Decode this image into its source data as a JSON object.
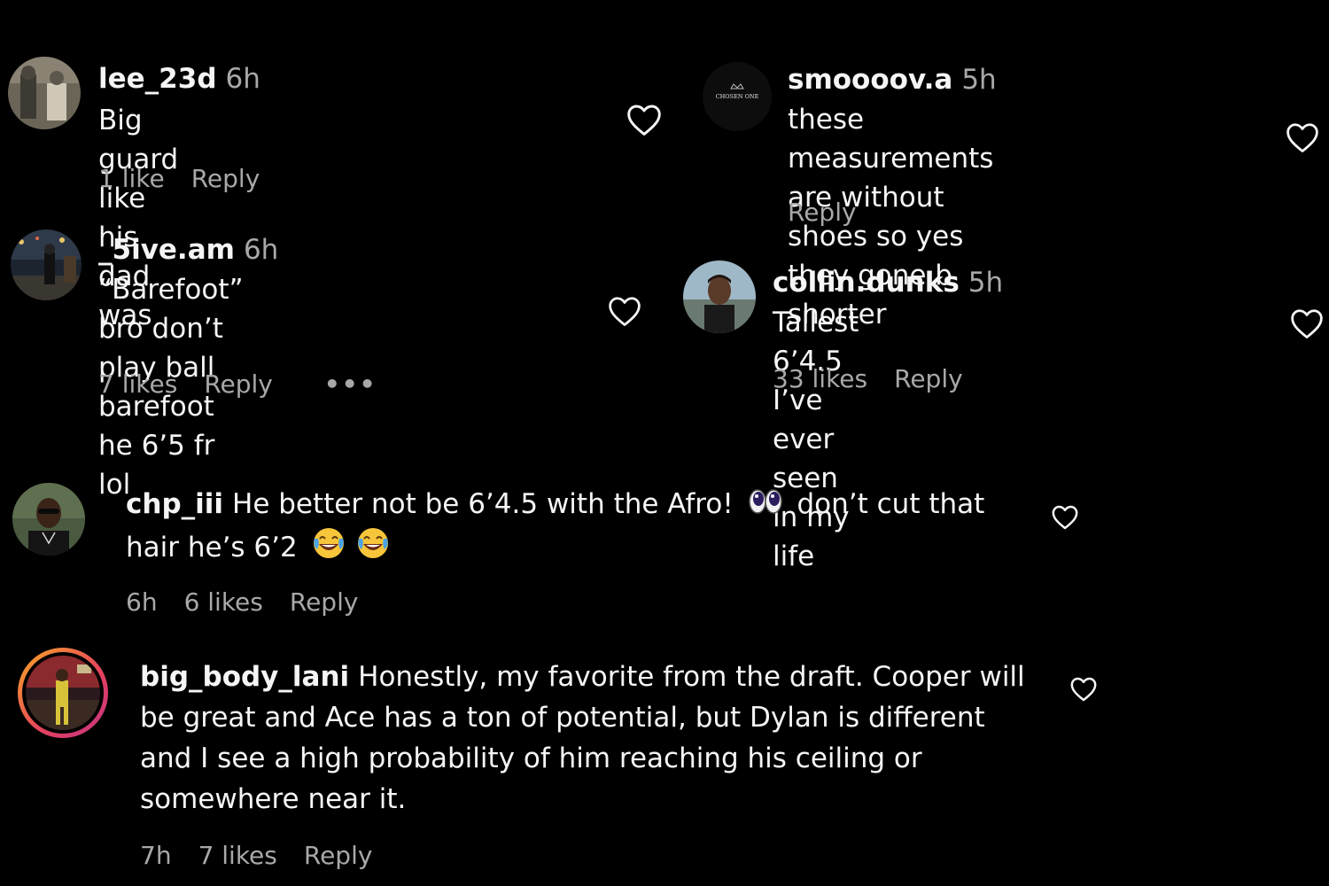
{
  "comments": [
    {
      "username": "lee_23d",
      "age": "6h",
      "lines": [
        "Big guard like his dad was"
      ],
      "likes": "1 like",
      "reply": "Reply"
    },
    {
      "username": "smoooov.a",
      "age": "5h",
      "avatar_text": "CHOSEN ONE",
      "lines": [
        "these measurements are without",
        "shoes so yes they gone b shorter"
      ],
      "reply": "Reply"
    },
    {
      "username": "_5ive.am",
      "age": "6h",
      "lines": [
        "“Barefoot” bro don’t play ball",
        "barefoot he 6’5 fr lol"
      ],
      "likes": "7 likes",
      "reply": "Reply",
      "more": "•••"
    },
    {
      "username": "collin.dunks",
      "age": "5h",
      "lines": [
        "Tallest 6’4.5 I’ve ever seen in my life"
      ],
      "likes": "33 likes",
      "reply": "Reply"
    },
    {
      "username": "chp_iii",
      "text_part1": "He better not be 6’4.5 with the Afro!",
      "emoji1": "eyes-emoji",
      "text_part2": "don’t cut that",
      "text_part3": "hair he’s 6’2",
      "emoji2": "tears-of-joy-emoji",
      "age": "6h",
      "likes": "6 likes",
      "reply": "Reply"
    },
    {
      "username": "big_body_lani",
      "text_part1": "Honestly, my favorite from the draft. Cooper will",
      "lines_rest": [
        "be great and Ace has a ton of potential, but Dylan is different",
        "and I see a high probability of him reaching his ceiling or",
        "somewhere near it."
      ],
      "age": "7h",
      "likes": "7 likes",
      "reply": "Reply"
    }
  ],
  "colors": {
    "background": "#000000",
    "text": "#f5f5f5",
    "secondary": "#a8a8a8",
    "story_ring_start": "#f9a825",
    "story_ring_end": "#d81b60"
  },
  "icons": {
    "like": "heart-outline-icon",
    "more": "more-options-icon"
  }
}
